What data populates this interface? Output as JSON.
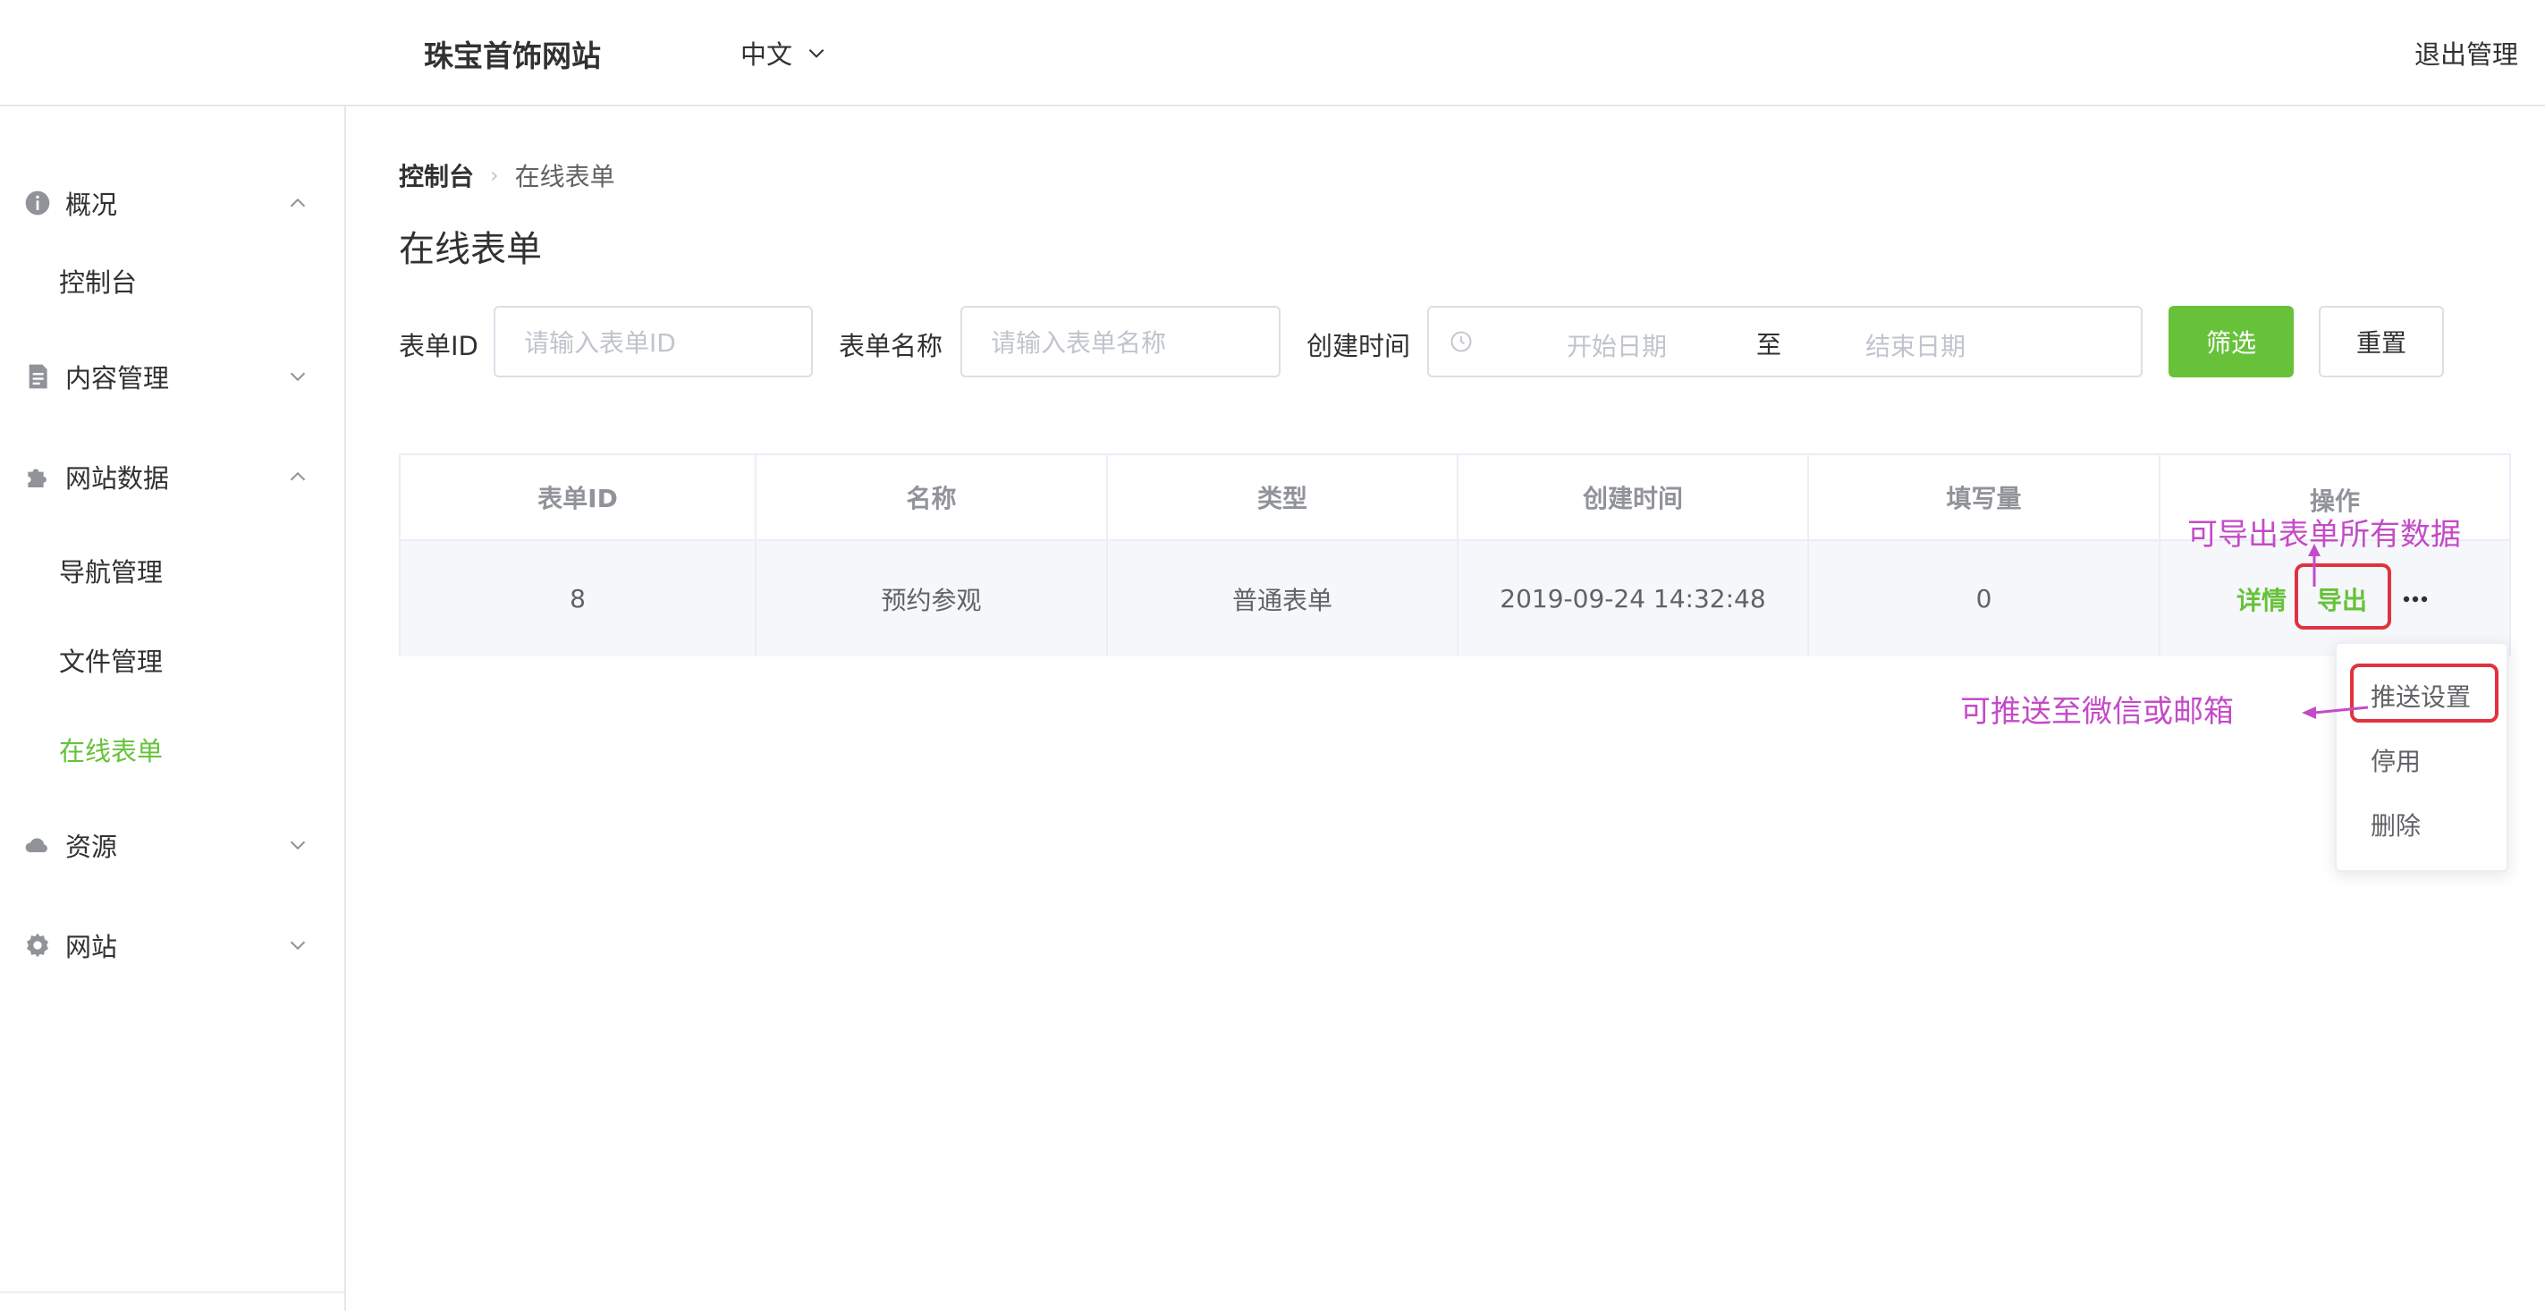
{
  "header": {
    "site_title": "珠宝首饰网站",
    "language": "中文",
    "logout": "退出管理"
  },
  "sidebar": {
    "groups": [
      {
        "label": "概况",
        "icon": "info-icon",
        "expanded": true,
        "items": [
          "控制台"
        ]
      },
      {
        "label": "内容管理",
        "icon": "document-icon",
        "expanded": false,
        "items": []
      },
      {
        "label": "网站数据",
        "icon": "puzzle-icon",
        "expanded": true,
        "items": [
          "导航管理",
          "文件管理",
          "在线表单"
        ]
      },
      {
        "label": "资源",
        "icon": "cloud-icon",
        "expanded": false,
        "items": []
      },
      {
        "label": "网站",
        "icon": "gear-icon",
        "expanded": false,
        "items": []
      }
    ],
    "active_item": "在线表单"
  },
  "breadcrumb": {
    "home": "控制台",
    "current": "在线表单"
  },
  "page_title": "在线表单",
  "filters": {
    "id_label": "表单ID",
    "id_placeholder": "请输入表单ID",
    "name_label": "表单名称",
    "name_placeholder": "请输入表单名称",
    "time_label": "创建时间",
    "start_placeholder": "开始日期",
    "range_separator": "至",
    "end_placeholder": "结束日期",
    "filter_button": "筛选",
    "reset_button": "重置"
  },
  "table": {
    "columns": [
      "表单ID",
      "名称",
      "类型",
      "创建时间",
      "填写量",
      "操作"
    ],
    "rows": [
      {
        "id": "8",
        "name": "预约参观",
        "type": "普通表单",
        "created": "2019-09-24 14:32:48",
        "count": "0",
        "actions": {
          "detail": "详情",
          "export": "导出"
        }
      }
    ]
  },
  "dropdown": {
    "items": [
      "推送设置",
      "停用",
      "删除"
    ]
  },
  "annotations": {
    "export_note": "可导出表单所有数据",
    "push_note": "可推送至微信或邮箱"
  },
  "colors": {
    "accent": "#67c23a",
    "annotation": "#c44bc7",
    "highlight": "#e0333f"
  }
}
